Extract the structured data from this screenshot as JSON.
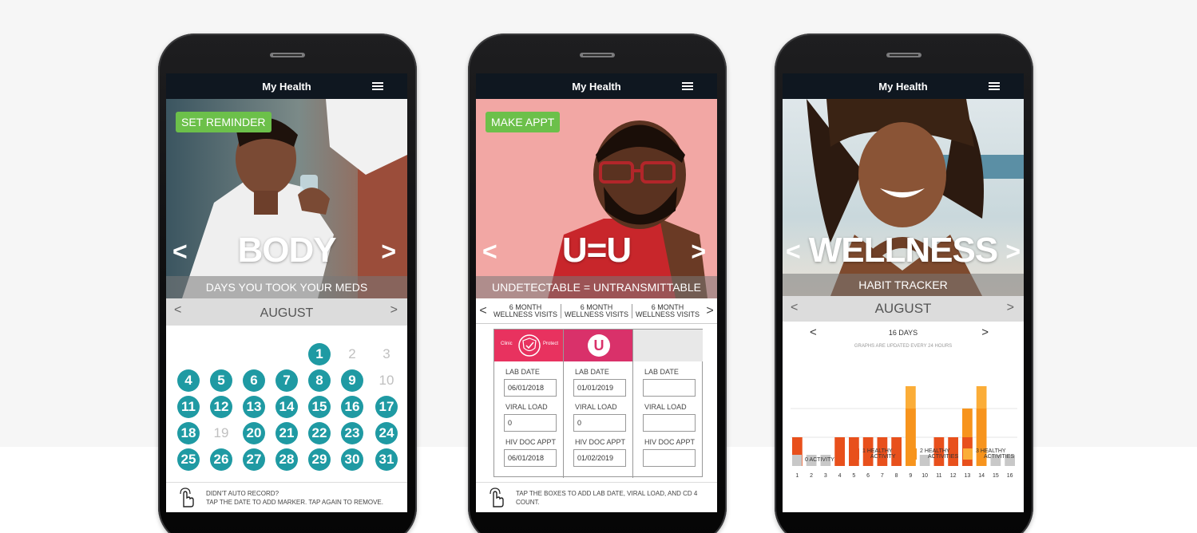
{
  "app_title": "My Health",
  "colors": {
    "green": "#6cc04a",
    "teal": "#1f9aa3",
    "red": "#e8501c",
    "orange": "#f7941d",
    "yellow": "#fbad38",
    "gray": "#c8c8c8"
  },
  "body": {
    "button": "SET REMINDER",
    "title": "BODY",
    "subtitle": "DAYS YOU TOOK YOUR MEDS",
    "month": "AUGUST",
    "prev": "<",
    "next": ">",
    "days": [
      {
        "n": "1",
        "on": true
      },
      {
        "n": "2",
        "on": false
      },
      {
        "n": "3",
        "on": false
      },
      {
        "n": "4",
        "on": true
      },
      {
        "n": "5",
        "on": true
      },
      {
        "n": "6",
        "on": true
      },
      {
        "n": "7",
        "on": true
      },
      {
        "n": "8",
        "on": true
      },
      {
        "n": "9",
        "on": true
      },
      {
        "n": "10",
        "on": false
      },
      {
        "n": "11",
        "on": true
      },
      {
        "n": "12",
        "on": true
      },
      {
        "n": "13",
        "on": true
      },
      {
        "n": "14",
        "on": true
      },
      {
        "n": "15",
        "on": true
      },
      {
        "n": "16",
        "on": true
      },
      {
        "n": "17",
        "on": true
      },
      {
        "n": "18",
        "on": true
      },
      {
        "n": "19",
        "on": false
      },
      {
        "n": "20",
        "on": true
      },
      {
        "n": "21",
        "on": true
      },
      {
        "n": "22",
        "on": true
      },
      {
        "n": "23",
        "on": true
      },
      {
        "n": "24",
        "on": true
      },
      {
        "n": "25",
        "on": true
      },
      {
        "n": "26",
        "on": true
      },
      {
        "n": "27",
        "on": true
      },
      {
        "n": "28",
        "on": true
      },
      {
        "n": "29",
        "on": true
      },
      {
        "n": "30",
        "on": true
      },
      {
        "n": "31",
        "on": true
      }
    ],
    "footer_line1": "DIDN'T AUTO RECORD?",
    "footer_line2": "TAP THE DATE TO ADD MARKER. TAP AGAIN TO REMOVE."
  },
  "uu": {
    "button": "MAKE APPT",
    "title": "U=U",
    "subtitle": "UNDETECTABLE = UNTRANSMITTABLE",
    "visit_tab_line1": "6 MONTH",
    "visit_tab_line2": "WELLNESS VISITS",
    "badge_left": "Clinic",
    "badge_right": "Protect",
    "badge_mid": "U",
    "columns": [
      {
        "lab_label": "LAB DATE",
        "lab_value": "06/01/2018",
        "viral_label": "VIRAL LOAD",
        "viral_value": "0",
        "appt_label": "HIV DOC APPT",
        "appt_value": "06/01/2018"
      },
      {
        "lab_label": "LAB DATE",
        "lab_value": "01/01/2019",
        "viral_label": "VIRAL LOAD",
        "viral_value": "0",
        "appt_label": "HIV DOC APPT",
        "appt_value": "01/02/2019"
      },
      {
        "lab_label": "LAB DATE",
        "lab_value": "",
        "viral_label": "VIRAL LOAD",
        "viral_value": "",
        "appt_label": "HIV DOC APPT",
        "appt_value": ""
      }
    ],
    "footer_line1": "TAP THE BOXES TO ADD LAB DATE, VIRAL LOAD, AND CD 4",
    "footer_line2": "COUNT."
  },
  "wellness": {
    "title": "WELLNESS",
    "subtitle": "HABIT TRACKER",
    "month": "AUGUST",
    "days_label": "16 DAYS",
    "graph_note": "GRAPHS ARE UPDATED EVERY 24 HOURS",
    "legend": [
      {
        "line1": "0",
        "line2": "ACTIVITY",
        "color": "#c8c8c8"
      },
      {
        "line1": "1  HEALTHY",
        "line2": "ACTIVITY",
        "color": "#e8501c"
      },
      {
        "line1": "2  HEALTHY",
        "line2": "ACTIVITIES",
        "color": "#f7941d"
      },
      {
        "line1": "3  HEALTHY",
        "line2": "ACTIVITIES",
        "color": "#fbad38"
      }
    ],
    "chart_data": {
      "type": "bar",
      "categories": [
        "1",
        "2",
        "3",
        "4",
        "5",
        "6",
        "7",
        "8",
        "9",
        "10",
        "11",
        "12",
        "13",
        "14",
        "15",
        "16"
      ],
      "values": [
        1,
        0,
        0,
        1,
        1,
        1,
        1,
        1,
        3,
        0,
        1,
        1,
        2,
        3,
        0,
        0
      ],
      "ylim": [
        0,
        3
      ]
    }
  }
}
